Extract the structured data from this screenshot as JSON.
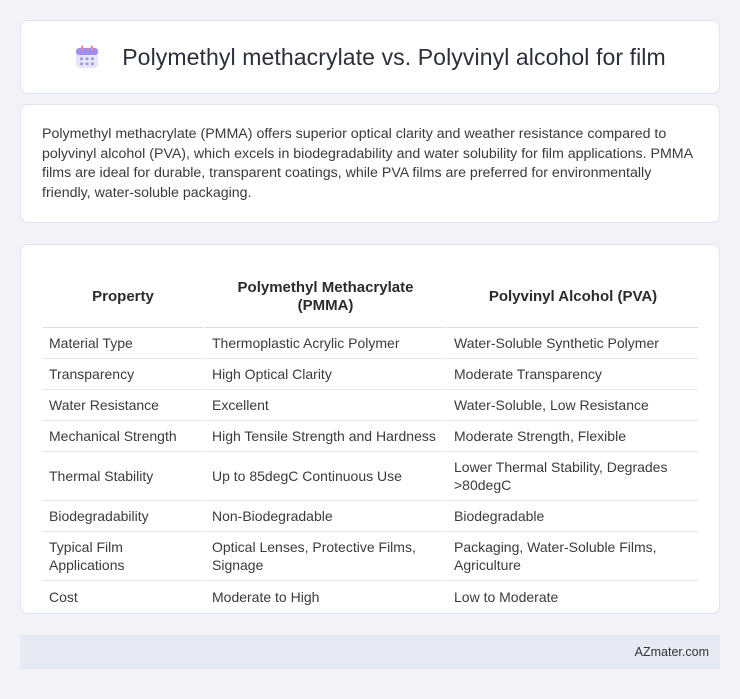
{
  "header": {
    "title": "Polymethyl methacrylate vs. Polyvinyl alcohol for film",
    "icon": "calendar-icon"
  },
  "description": "Polymethyl methacrylate (PMMA) offers superior optical clarity and weather resistance compared to polyvinyl alcohol (PVA), which excels in biodegradability and water solubility for film applications. PMMA films are ideal for durable, transparent coatings, while PVA films are preferred for environmentally friendly, water-soluble packaging.",
  "table": {
    "headers": [
      "Property",
      "Polymethyl Methacrylate (PMMA)",
      "Polyvinyl Alcohol (PVA)"
    ],
    "rows": [
      [
        "Material Type",
        "Thermoplastic Acrylic Polymer",
        "Water-Soluble Synthetic Polymer"
      ],
      [
        "Transparency",
        "High Optical Clarity",
        "Moderate Transparency"
      ],
      [
        "Water Resistance",
        "Excellent",
        "Water-Soluble, Low Resistance"
      ],
      [
        "Mechanical Strength",
        "High Tensile Strength and Hardness",
        "Moderate Strength, Flexible"
      ],
      [
        "Thermal Stability",
        "Up to 85degC Continuous Use",
        "Lower Thermal Stability, Degrades >80degC"
      ],
      [
        "Biodegradability",
        "Non-Biodegradable",
        "Biodegradable"
      ],
      [
        "Typical Film Applications",
        "Optical Lenses, Protective Films, Signage",
        "Packaging, Water-Soluble Films, Agriculture"
      ],
      [
        "Cost",
        "Moderate to High",
        "Low to Moderate"
      ]
    ]
  },
  "footer": {
    "brand": "AZmater.com"
  }
}
